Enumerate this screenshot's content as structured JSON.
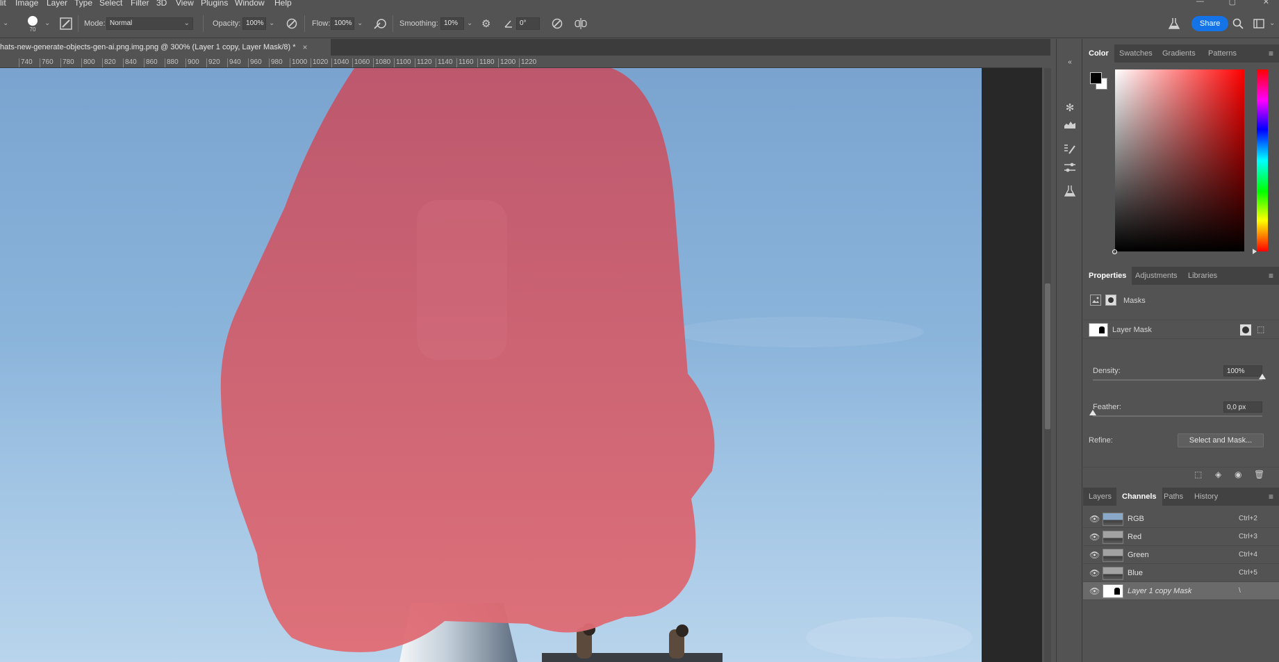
{
  "menu": {
    "items": [
      "lit",
      "Image",
      "Layer",
      "Type",
      "Select",
      "Filter",
      "3D",
      "View",
      "Plugins",
      "Window",
      "Help"
    ]
  },
  "options_bar": {
    "brush_size": "70",
    "mode_label": "Mode:",
    "mode_value": "Normal",
    "opacity_label": "Opacity:",
    "opacity_value": "100%",
    "flow_label": "Flow:",
    "flow_value": "100%",
    "smoothing_label": "Smoothing:",
    "smoothing_value": "10%",
    "angle_value": "0°",
    "share_label": "Share"
  },
  "document": {
    "tab_title": "hats-new-generate-objects-gen-ai.png.img.png @ 300% (Layer 1 copy, Layer Mask/8) *",
    "close_glyph": "×",
    "ruler_ticks": [
      "740",
      "760",
      "780",
      "800",
      "820",
      "840",
      "860",
      "880",
      "900",
      "920",
      "940",
      "960",
      "980",
      "1000",
      "1020",
      "1040",
      "1060",
      "1080",
      "1100",
      "1120",
      "1140",
      "1160",
      "1180",
      "1200",
      "1220"
    ]
  },
  "color_panel": {
    "tabs": [
      "Color",
      "Swatches",
      "Gradients",
      "Patterns"
    ],
    "active_tab": "Color",
    "foreground_color": "#000000",
    "background_color": "#ffffff"
  },
  "properties_panel": {
    "tabs": [
      "Properties",
      "Adjustments",
      "Libraries"
    ],
    "active_tab": "Properties",
    "section_label": "Masks",
    "mask_name": "Layer Mask",
    "density_label": "Density:",
    "density_value": "100%",
    "density_level": 1.0,
    "feather_label": "Feather:",
    "feather_value": "0,0 px",
    "feather_level": 0.0,
    "refine_label": "Refine:",
    "select_mask_button": "Select and Mask..."
  },
  "channels_panel": {
    "tabs": [
      "Layers",
      "Channels",
      "Paths",
      "History"
    ],
    "active_tab": "Channels",
    "rows": [
      {
        "name": "RGB",
        "shortcut": "Ctrl+2",
        "thumb": "color"
      },
      {
        "name": "Red",
        "shortcut": "Ctrl+3",
        "thumb": "gray"
      },
      {
        "name": "Green",
        "shortcut": "Ctrl+4",
        "thumb": "gray"
      },
      {
        "name": "Blue",
        "shortcut": "Ctrl+5",
        "thumb": "gray"
      },
      {
        "name": "Layer 1 copy Mask",
        "shortcut": "\\",
        "thumb": "mask",
        "selected": true
      }
    ]
  },
  "colors": {
    "accent": "#1473e6",
    "mask_overlay": "#e0606c"
  },
  "icons": {
    "brush_tip": "brush-tip-icon",
    "brush_panel": "brush-settings-icon",
    "airbrush": "airbrush-icon",
    "pressure": "pressure-icon",
    "gear": "gear-icon",
    "angle": "angle-icon",
    "symmetry": "symmetry-icon",
    "search": "search-icon",
    "workspace": "workspace-icon",
    "labs": "flask-icon"
  }
}
